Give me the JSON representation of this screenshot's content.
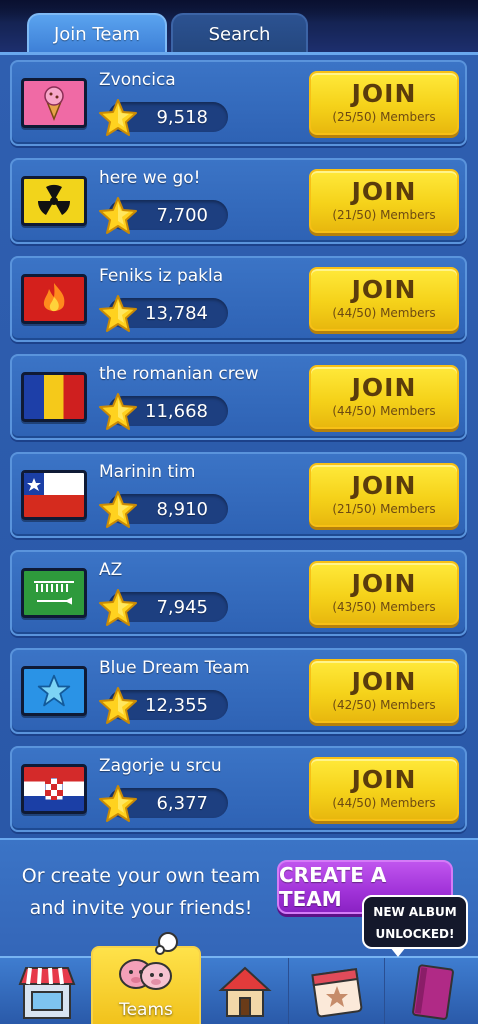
{
  "tabs": {
    "join_team": "Join Team",
    "search": "Search"
  },
  "teams": [
    {
      "name": "Zvoncica",
      "score": "9,518",
      "join": "JOIN",
      "members": "(25/50) Members",
      "flag": "ice-cream-flag"
    },
    {
      "name": "here we go!",
      "score": "7,700",
      "join": "JOIN",
      "members": "(21/50) Members",
      "flag": "radiation-flag"
    },
    {
      "name": "Feniks iz pakla",
      "score": "13,784",
      "join": "JOIN",
      "members": "(44/50) Members",
      "flag": "fire-flag"
    },
    {
      "name": "the romanian crew",
      "score": "11,668",
      "join": "JOIN",
      "members": "(44/50) Members",
      "flag": "romania-flag"
    },
    {
      "name": "Marinin tim",
      "score": "8,910",
      "join": "JOIN",
      "members": "(21/50) Members",
      "flag": "chile-flag"
    },
    {
      "name": "AZ",
      "score": "7,945",
      "join": "JOIN",
      "members": "(43/50) Members",
      "flag": "green-bar-flag"
    },
    {
      "name": "Blue Dream Team",
      "score": "12,355",
      "join": "JOIN",
      "members": "(42/50) Members",
      "flag": "blue-star-flag"
    },
    {
      "name": "Zagorje u srcu",
      "score": "6,377",
      "join": "JOIN",
      "members": "(44/50) Members",
      "flag": "croatia-flag"
    }
  ],
  "create": {
    "line1": "Or create your own team",
    "line2": "and invite your friends!",
    "button": "CREATE A TEAM"
  },
  "tooltip": {
    "line1": "NEW ALBUM",
    "line2": "UNLOCKED!"
  },
  "nav": {
    "teams_label": "Teams"
  },
  "colors": {
    "join_yellow": "#f5d21a",
    "create_purple": "#a032d8",
    "panel_blue": "#2f5fb0"
  }
}
